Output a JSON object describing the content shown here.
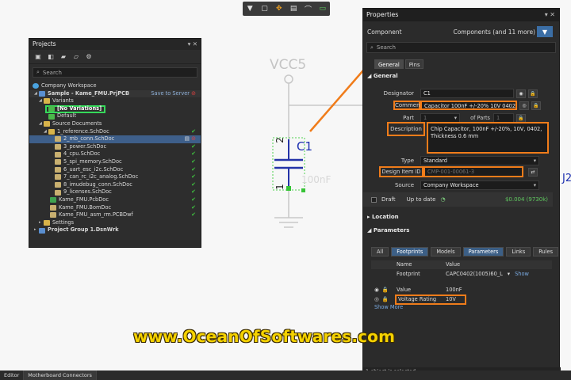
{
  "canvas": {
    "net_label": "VCC5",
    "designator": "C1",
    "pin_top": "2",
    "pin_bottom": "1",
    "ghost_value": "100nF",
    "edge_label": "J2"
  },
  "projects_panel": {
    "title": "Projects",
    "search_placeholder": "Search",
    "tree": [
      {
        "label": "Company Workspace",
        "icon": "workspace-icon",
        "level": 0
      },
      {
        "label": "Sample - Kame_FMU.PrjPCB",
        "icon": "project-icon",
        "level": 0,
        "extra": "Save to Server"
      },
      {
        "label": "Variants",
        "icon": "folder-icon",
        "level": 1
      },
      {
        "label": "[No Variations]",
        "icon": "variant-icon",
        "level": 2
      },
      {
        "label": "Default",
        "icon": "variant-icon",
        "level": 2
      },
      {
        "label": "Source Documents",
        "icon": "folder-icon",
        "level": 1
      },
      {
        "label": "1_reference.SchDoc",
        "icon": "folder-icon",
        "level": 2
      },
      {
        "label": "2_mb_conn.SchDoc",
        "icon": "doc-icon",
        "level": 3,
        "selected": true
      },
      {
        "label": "3_power.SchDoc",
        "icon": "doc-icon",
        "level": 3
      },
      {
        "label": "4_cpu.SchDoc",
        "icon": "doc-icon",
        "level": 3
      },
      {
        "label": "5_spi_memory.SchDoc",
        "icon": "doc-icon",
        "level": 3
      },
      {
        "label": "6_uart_esc_i2c.SchDoc",
        "icon": "doc-icon",
        "level": 3
      },
      {
        "label": "7_can_rc_i2c_analog.SchDoc",
        "icon": "doc-icon",
        "level": 3
      },
      {
        "label": "8_imudebug_conn.SchDoc",
        "icon": "doc-icon",
        "level": 3
      },
      {
        "label": "9_licenses.SchDoc",
        "icon": "doc-icon",
        "level": 3
      },
      {
        "label": "Kame_FMU.PcbDoc",
        "icon": "pcb-icon",
        "level": 2
      },
      {
        "label": "Kame_FMU.BomDoc",
        "icon": "doc-icon",
        "level": 2
      },
      {
        "label": "Kame_FMU_asm_rm.PCBDwf",
        "icon": "doc-icon",
        "level": 2
      },
      {
        "label": "Settings",
        "icon": "folder-icon",
        "level": 1
      },
      {
        "label": "Project Group 1.DsnWrk",
        "icon": "project-icon",
        "level": 0
      }
    ]
  },
  "properties_panel": {
    "title": "Properties",
    "object_kind": "Component",
    "object_count": "Components (and 11 more)",
    "search_placeholder": "Search",
    "tabs": [
      "General",
      "Pins"
    ],
    "general_header": "General",
    "fields": {
      "designator_label": "Designator",
      "designator_value": "C1",
      "comment_label": "Comment",
      "comment_value": "Capacitor 100nF +/-20% 10V 0402",
      "part_label": "Part",
      "part_value": "1",
      "part_of": "of Parts",
      "part_total": "1",
      "description_label": "Description",
      "description_value": "Chip Capacitor, 100nF +/-20%, 10V, 0402, Thickness 0.6 mm",
      "type_label": "Type",
      "type_value": "Standard",
      "design_item_label": "Design Item ID",
      "design_item_value": "CMP-001-00061-3",
      "source_label": "Source",
      "source_value": "Company Workspace",
      "draft_label": "Draft",
      "uptodate_label": "Up to date",
      "price": "$0.004 (9730k)"
    },
    "location_header": "Location",
    "parameters_header": "Parameters",
    "param_tabs": [
      "All",
      "Footprints",
      "Models",
      "Parameters",
      "Links",
      "Rules"
    ],
    "param_columns": [
      "Name",
      "Value"
    ],
    "param_rows": [
      {
        "name": "Footprint",
        "value": "CAPC0402(1005)60_L",
        "extra": "Show"
      },
      {
        "name": "Value",
        "value": "100nF"
      },
      {
        "name": "Voltage Rating",
        "value": "10V"
      }
    ],
    "show_more": "Show More",
    "status": "1 object is selected"
  },
  "bottom_tabs": [
    "Editor",
    "Motherboard Connectors"
  ],
  "watermark": "www.OceanOfSoftwares.com",
  "colors": {
    "highlight_orange": "#f07c1a",
    "highlight_green": "#35d95a",
    "accent_blue": "#3b6ea5"
  }
}
